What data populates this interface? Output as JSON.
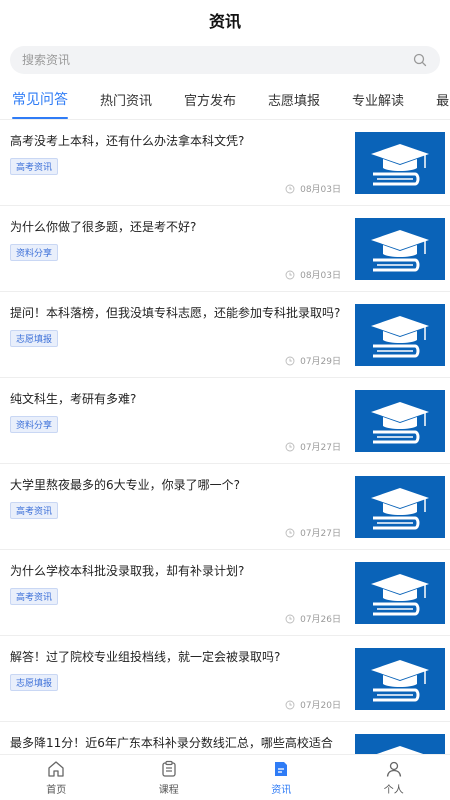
{
  "header": {
    "title": "资讯"
  },
  "search": {
    "placeholder": "搜索资讯"
  },
  "tabs": [
    {
      "label": "常见问答",
      "active": true
    },
    {
      "label": "热门资讯"
    },
    {
      "label": "官方发布"
    },
    {
      "label": "志愿填报"
    },
    {
      "label": "专业解读"
    },
    {
      "label": "最"
    }
  ],
  "articles": [
    {
      "title": "高考没考上本科，还有什么办法拿本科文凭?",
      "tag": "高考资讯",
      "date": "08月03日"
    },
    {
      "title": "为什么你做了很多题，还是考不好?",
      "tag": "资料分享",
      "date": "08月03日"
    },
    {
      "title": "提问！本科落榜，但我没填专科志愿，还能参加专科批录取吗?",
      "tag": "志愿填报",
      "date": "07月29日"
    },
    {
      "title": "纯文科生，考研有多难?",
      "tag": "资料分享",
      "date": "07月27日"
    },
    {
      "title": "大学里熬夜最多的6大专业，你录了哪一个?",
      "tag": "高考资讯",
      "date": "07月27日"
    },
    {
      "title": "为什么学校本科批没录取我，却有补录计划?",
      "tag": "高考资讯",
      "date": "07月26日"
    },
    {
      "title": "解答！过了院校专业组投档线，就一定会被录取吗?",
      "tag": "志愿填报",
      "date": "07月20日"
    },
    {
      "title": "最多降11分！近6年广东本科补录分数线汇总，哪些高校适合捡",
      "tag": "",
      "date": ""
    }
  ],
  "tabbar": [
    {
      "label": "首页",
      "icon": "home-icon"
    },
    {
      "label": "课程",
      "icon": "course-icon"
    },
    {
      "label": "资讯",
      "icon": "news-icon",
      "active": true
    },
    {
      "label": "个人",
      "icon": "profile-icon"
    }
  ],
  "colors": {
    "accent": "#2f7cf6",
    "thumb_bg": "#0a63b8"
  }
}
